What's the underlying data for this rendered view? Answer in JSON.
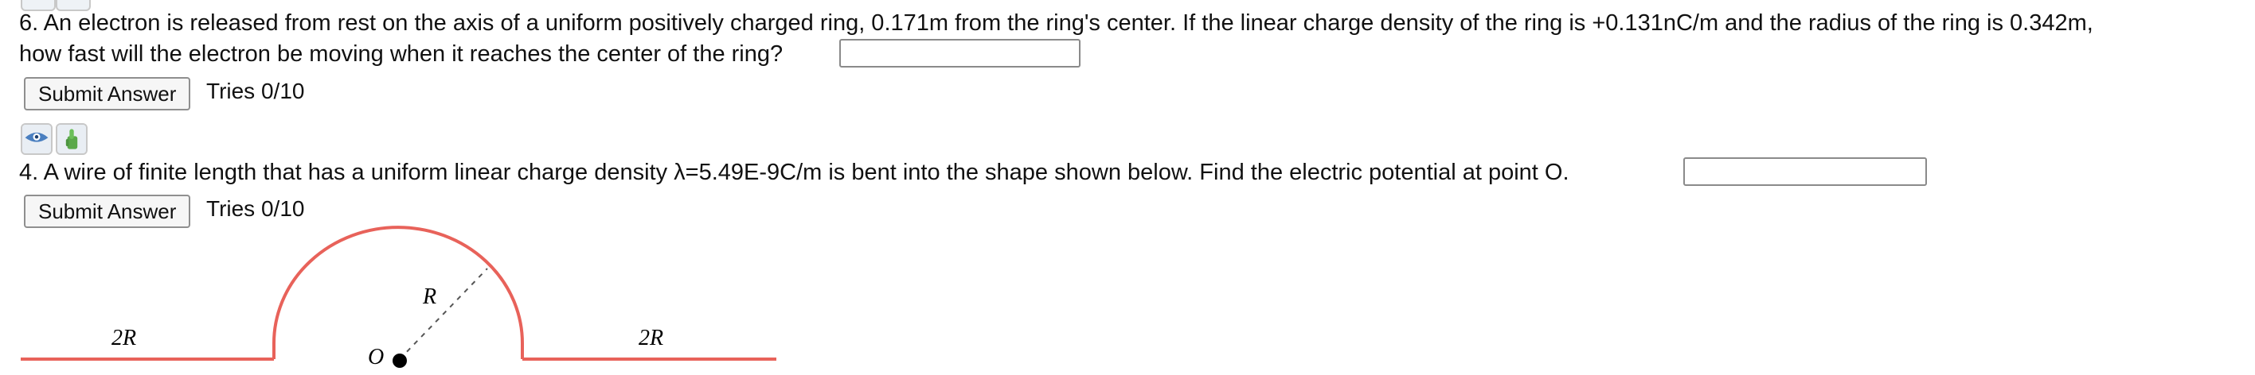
{
  "question6": {
    "line1": "6. An electron is released from rest on the axis of a uniform positively charged ring, 0.171m from the ring's center. If the linear charge density of the ring is +0.131nC/m and the radius of the ring is 0.342m,",
    "line2": "how fast will the electron be moving when it reaches the center of the ring?",
    "answer_value": "",
    "submit_label": "Submit Answer",
    "tries": "Tries 0/10"
  },
  "question4": {
    "text": "4. A wire of finite length that has a uniform linear charge density λ=5.49E-9C/m is bent into the shape shown below. Find the electric potential at point O.",
    "answer_value": "",
    "submit_label": "Submit Answer",
    "tries": "Tries 0/10"
  },
  "icons": [
    "discussion-icon",
    "hint-icon"
  ],
  "figure": {
    "left_label": "2R",
    "right_label": "2R",
    "radius_label": "R",
    "point_label": "O",
    "wire_color": "#e8625a"
  }
}
